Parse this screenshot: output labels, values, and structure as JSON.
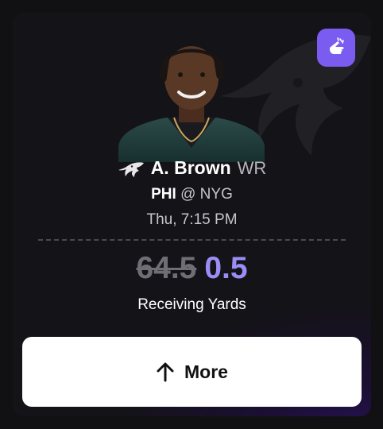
{
  "player": {
    "first_initial": "A.",
    "last_name": "Brown",
    "display_name": "A. Brown",
    "position": "WR",
    "team_logo_icon": "eagles-logo-icon",
    "photo": "player-headshot"
  },
  "game": {
    "home_team": "PHI",
    "at_symbol": "@",
    "away_team": "NYG",
    "time": "Thu, 7:15 PM"
  },
  "projection": {
    "original_line": "64.5",
    "promo_line": "0.5",
    "stat_label": "Receiving Yards"
  },
  "actions": {
    "more_label": "More",
    "more_icon": "arrow-up-icon"
  },
  "badge": {
    "icon": "pointing-hand-icon",
    "color": "#7b5cf0"
  },
  "colors": {
    "promo_line": "#9a8df5",
    "strikethrough_line": "#6e6e74",
    "card_bg": "#141318",
    "accent_glow": "#2a1460"
  }
}
